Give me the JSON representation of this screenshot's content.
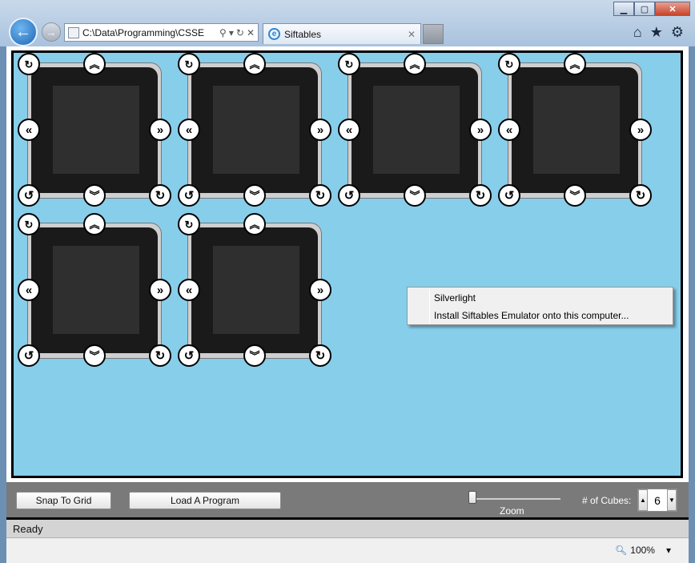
{
  "window": {
    "minimize_icon": "minimize-icon",
    "maximize_icon": "maximize-icon",
    "close_icon": "close-icon"
  },
  "nav": {
    "address": "C:\\Data\\Programming\\CSSE",
    "tab_title": "Siftables"
  },
  "cube_buttons": {
    "rotate_tl": "↻",
    "up": "︽",
    "left": "«",
    "right": "»",
    "ccw": "↺",
    "down": "︾",
    "cw": "↻"
  },
  "context_menu": {
    "items": [
      "Silverlight",
      "Install Siftables Emulator onto this computer..."
    ]
  },
  "toolbar": {
    "snap_label": "Snap To Grid",
    "load_label": "Load A Program",
    "zoom_label": "Zoom",
    "zoom_level": 0,
    "cubes_label": "# of Cubes:",
    "cubes_value": "6"
  },
  "status": {
    "app_status": "Ready",
    "browser_zoom": "100%"
  },
  "colors": {
    "canvas_bg": "#87ceeb",
    "toolbar_bg": "#7a7a7a"
  }
}
